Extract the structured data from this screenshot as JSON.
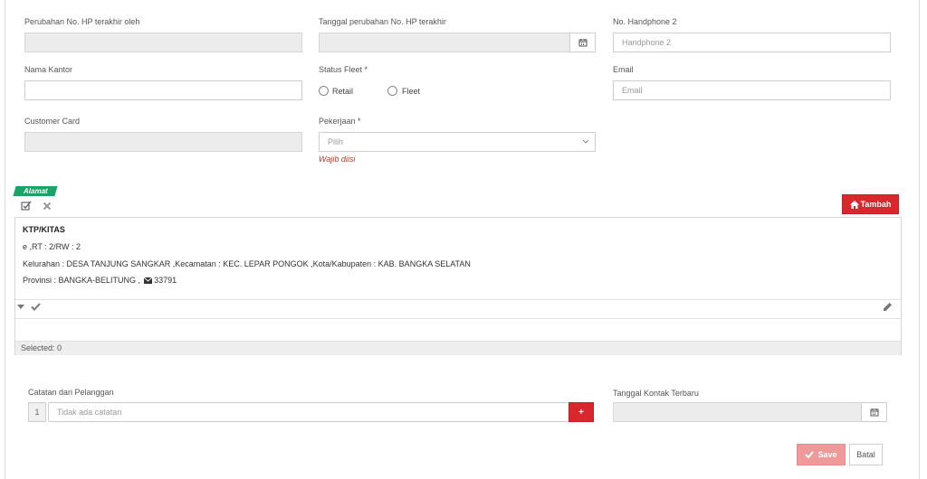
{
  "form": {
    "row1": {
      "hp_changed_by": {
        "label": "Perubahan No. HP terakhir oleh",
        "value": ""
      },
      "hp_changed_date": {
        "label": "Tanggal perubahan No. HP terakhir",
        "value": ""
      },
      "handphone2": {
        "label": "No. Handphone 2",
        "placeholder": "Handphone 2"
      }
    },
    "row2": {
      "nama_kantor": {
        "label": "Nama Kantor",
        "value": ""
      },
      "status_fleet": {
        "label": "Status Fleet *",
        "options": [
          "Retail",
          "Fleet"
        ],
        "selected": ""
      },
      "email": {
        "label": "Email",
        "placeholder": "Email"
      }
    },
    "row3": {
      "customer_card": {
        "label": "Customer Card",
        "value": ""
      },
      "pekerjaan": {
        "label": "Pekerjaan *",
        "placeholder": "Pilih",
        "error": "Wajib diisi"
      }
    }
  },
  "alamat": {
    "tag": "Alamat",
    "add_button": "Tambah",
    "address": {
      "type": "KTP/KITAS",
      "line1": "e ,RT : 2/RW : 2",
      "line2": "Kelurahan : DESA TANJUNG SANGKAR ,Kecamatan : KEC. LEPAR PONGOK ,Kota/Kabupaten : KAB. BANGKA SELATAN",
      "line3_prefix": "Provinsi : BANGKA-BELITUNG ,",
      "postal": "33791"
    },
    "selected_text": "Selected: 0"
  },
  "notes": {
    "label": "Catatan dari Pelanggan",
    "row_number": "1",
    "placeholder": "Tidak ada catatan",
    "add_symbol": "+"
  },
  "contact": {
    "label": "Tanggal Kontak Terbaru",
    "value": ""
  },
  "actions": {
    "save": "Save",
    "cancel": "Batal"
  },
  "colors": {
    "primary_red": "#d9272e",
    "save_disabled": "#ef9a9a",
    "tag_green": "#1aa367",
    "error": "#c0392b"
  }
}
